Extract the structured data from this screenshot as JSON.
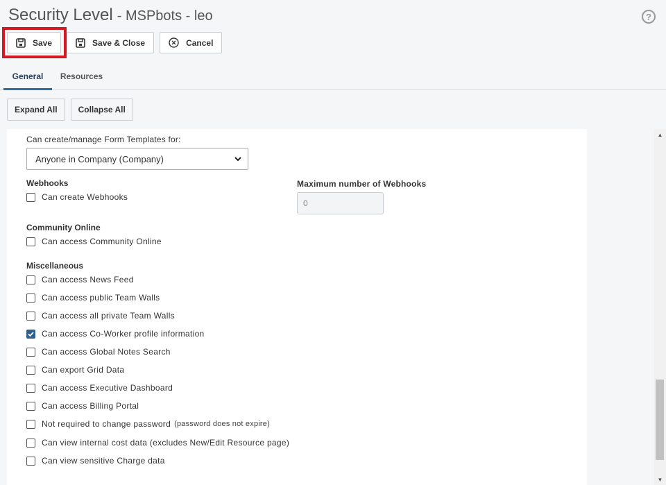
{
  "header": {
    "title": "Security Level",
    "subtitle": "- MSPbots - leo",
    "help_icon": "question-circle-icon"
  },
  "toolbar": {
    "save_label": "Save",
    "save_close_label": "Save & Close",
    "cancel_label": "Cancel"
  },
  "tabs": [
    {
      "label": "General",
      "active": true
    },
    {
      "label": "Resources",
      "active": false
    }
  ],
  "expand_collapse": {
    "expand_label": "Expand All",
    "collapse_label": "Collapse All"
  },
  "form": {
    "form_templates_label": "Can create/manage Form Templates for:",
    "form_templates_value": "Anyone in Company (Company)",
    "webhooks": {
      "title": "Webhooks",
      "create_label": "Can create Webhooks",
      "create_checked": false,
      "max_label": "Maximum number of Webhooks",
      "max_value": "0"
    },
    "community": {
      "title": "Community Online",
      "access_label": "Can access Community Online",
      "access_checked": false
    },
    "misc": {
      "title": "Miscellaneous",
      "items": [
        {
          "label": "Can access News Feed",
          "checked": false
        },
        {
          "label": "Can access public Team Walls",
          "checked": false
        },
        {
          "label": "Can access all private Team Walls",
          "checked": false
        },
        {
          "label": "Can access Co-Worker profile information",
          "checked": true
        },
        {
          "label": "Can access Global Notes Search",
          "checked": false
        },
        {
          "label": "Can export Grid Data",
          "checked": false
        },
        {
          "label": "Can access Executive Dashboard",
          "checked": false
        },
        {
          "label": "Can access Billing Portal",
          "checked": false
        },
        {
          "label": "Not required to change password",
          "note": "(password does not expire)",
          "checked": false
        },
        {
          "label": "Can view internal cost data (excludes New/Edit Resource page)",
          "checked": false
        },
        {
          "label": "Can view sensitive Charge data",
          "checked": false
        }
      ]
    }
  },
  "colors": {
    "accent": "#2f6c9f",
    "checkbox_checked": "#2f5f8c",
    "highlight": "#d11b22"
  }
}
